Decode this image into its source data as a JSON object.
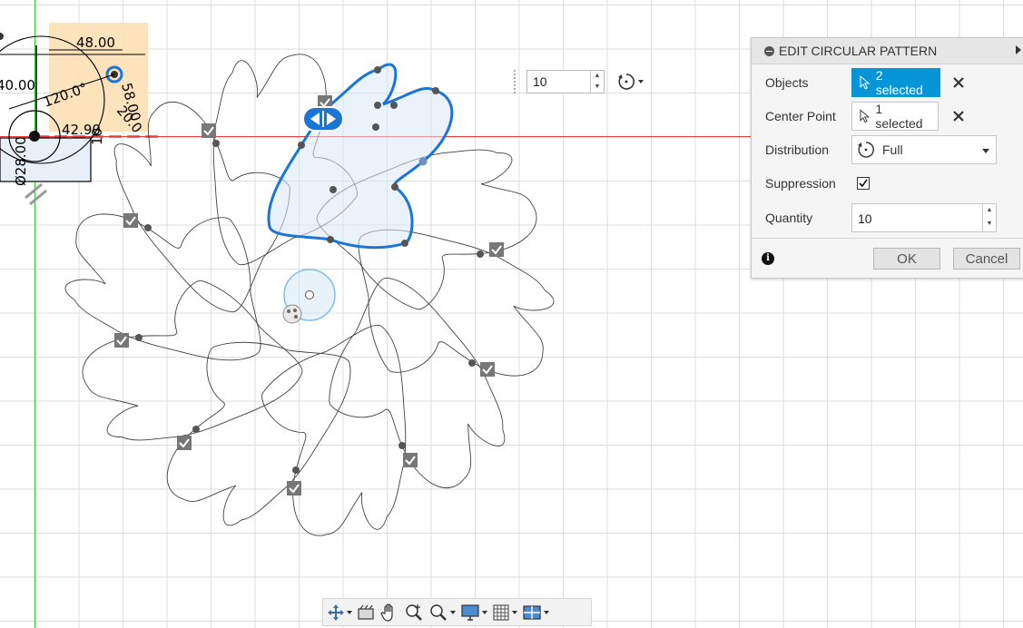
{
  "dimensions": {
    "d1": "48.00",
    "d2": "40.00",
    "d3": "120.0°",
    "d4": "42.90",
    "d5": "Ø28.00",
    "d6": "58.00",
    "d7": "20.0",
    "d8": "10"
  },
  "float_input": {
    "quantity": "10",
    "distribution_icon": "circular-distribution-icon"
  },
  "dialog": {
    "title": "EDIT CIRCULAR PATTERN",
    "objects": {
      "label": "Objects",
      "value": "2 selected",
      "clear_icon": "clear-icon"
    },
    "center_point": {
      "label": "Center Point",
      "value": "1 selected",
      "clear_icon": "clear-icon"
    },
    "distribution": {
      "label": "Distribution",
      "value": "Full"
    },
    "suppression": {
      "label": "Suppression",
      "checked": true
    },
    "quantity": {
      "label": "Quantity",
      "value": "10"
    },
    "ok": "OK",
    "cancel": "Cancel"
  },
  "navbar": {
    "items": [
      "orbit-icon",
      "look-at-icon",
      "pan-icon",
      "zoom-icon",
      "fit-icon",
      "display-settings-icon",
      "grid-snap-icon",
      "viewports-icon"
    ]
  },
  "colors": {
    "accent": "#0696d7",
    "selection": "#1a75d6",
    "x_axis": "#ea3b3b",
    "y_axis": "#2ecc2e",
    "dim_highlight": "#fde0b5"
  }
}
